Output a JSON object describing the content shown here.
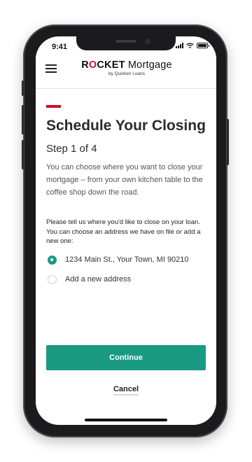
{
  "status_bar": {
    "time": "9:41"
  },
  "header": {
    "menu_icon": "hamburger-menu-icon",
    "logo_rocket_r": "R",
    "logo_rocket_o": "O",
    "logo_rocket_rest": "CKET",
    "logo_mortgage": " Mortgage",
    "logo_sub": "by Quicken Loans"
  },
  "main": {
    "title": "Schedule Your Closing",
    "step": "Step 1 of 4",
    "intro": "You can choose where you want to close your mortgage – from your own kitchen table to the coffee shop down the road.",
    "prompt": "Please tell us where you'd like to close on your loan. You can choose an address we have on file or add a new one:",
    "options": [
      {
        "label": "1234 Main St., Your Town, MI 90210",
        "selected": true
      },
      {
        "label": "Add a new address",
        "selected": false
      }
    ],
    "continue_label": "Continue",
    "cancel_label": "Cancel"
  },
  "colors": {
    "accent_red": "#c8102e",
    "primary_green": "#1a9a83"
  }
}
